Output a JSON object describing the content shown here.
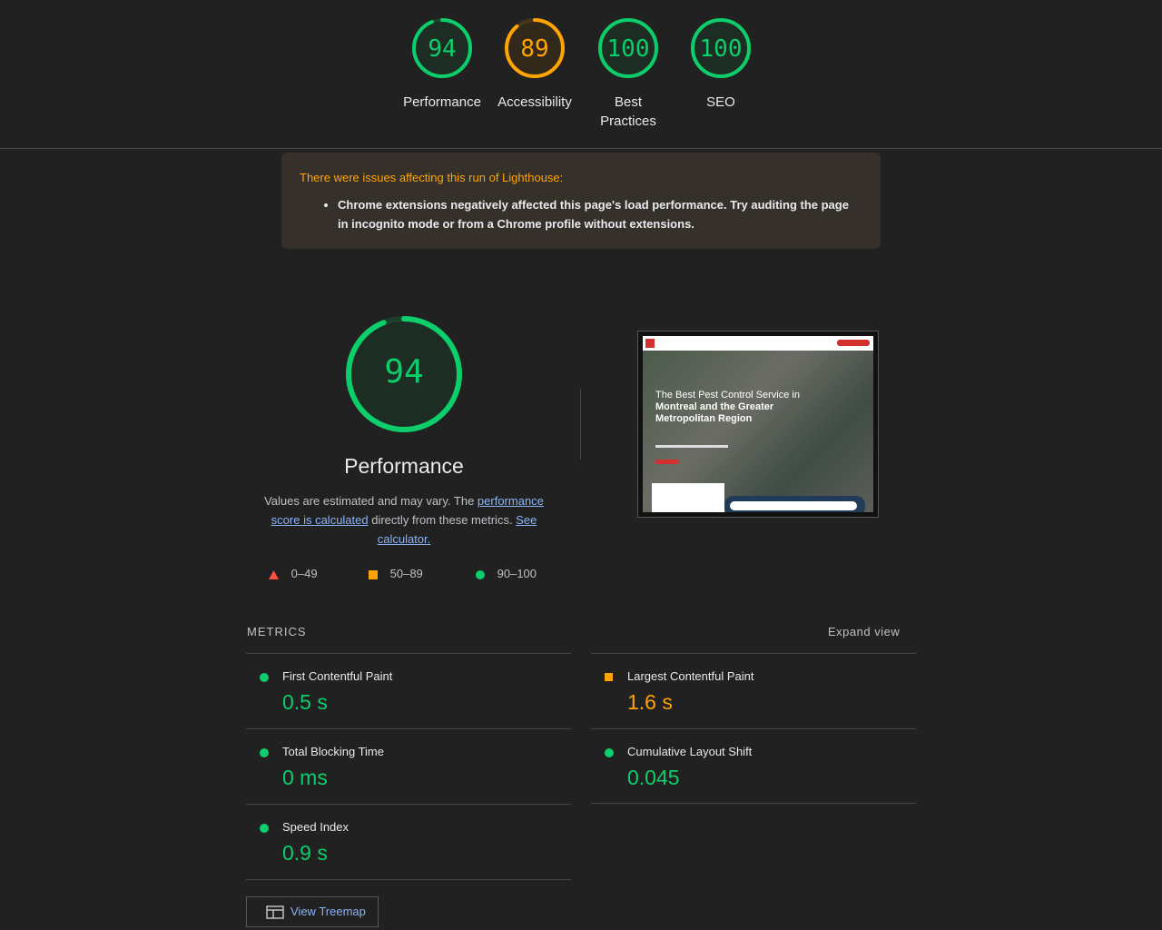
{
  "scores": [
    {
      "value": "94",
      "label": "Performance",
      "score": 0.94,
      "color": "#0cce6b"
    },
    {
      "value": "89",
      "label": "Accessibility",
      "score": 0.89,
      "color": "#ffa400"
    },
    {
      "value": "100",
      "label_line1": "Best",
      "label_line2": "Practices",
      "score": 1.0,
      "color": "#0cce6b"
    },
    {
      "value": "100",
      "label": "SEO",
      "score": 1.0,
      "color": "#0cce6b"
    }
  ],
  "warning": {
    "title": "There were issues affecting this run of Lighthouse:",
    "item": "Chrome extensions negatively affected this page's load performance. Try auditing the page in incognito mode or from a Chrome profile without extensions."
  },
  "performance": {
    "score": "94",
    "score_fraction": 0.94,
    "title": "Performance",
    "desc_prefix": "Values are estimated and may vary. The ",
    "link1": "performance score is calculated",
    "desc_middle": " directly from these metrics. ",
    "link2": "See calculator."
  },
  "legend": {
    "fail": "0–49",
    "average": "50–89",
    "pass": "90–100"
  },
  "screenshot": {
    "headline_1": "The Best Pest Control Service in",
    "headline_2": "Montreal and the Greater",
    "headline_3": "Metropolitan Region"
  },
  "metrics": {
    "header": "METRICS",
    "expand": "Expand view",
    "fcp": {
      "label": "First Contentful Paint",
      "value": "0.5 s",
      "status": "pass"
    },
    "lcp": {
      "label": "Largest Contentful Paint",
      "value": "1.6 s",
      "status": "average"
    },
    "tbt": {
      "label": "Total Blocking Time",
      "value": "0 ms",
      "status": "pass"
    },
    "cls": {
      "label": "Cumulative Layout Shift",
      "value": "0.045",
      "status": "pass"
    },
    "si": {
      "label": "Speed Index",
      "value": "0.9 s",
      "status": "pass"
    }
  },
  "treemap": {
    "label": "View Treemap",
    "icon": "treemap-icon"
  },
  "colors": {
    "pass": "#0cce6b",
    "average": "#ffa400",
    "fail": "#ff4e42",
    "link": "#8ab4f8"
  }
}
